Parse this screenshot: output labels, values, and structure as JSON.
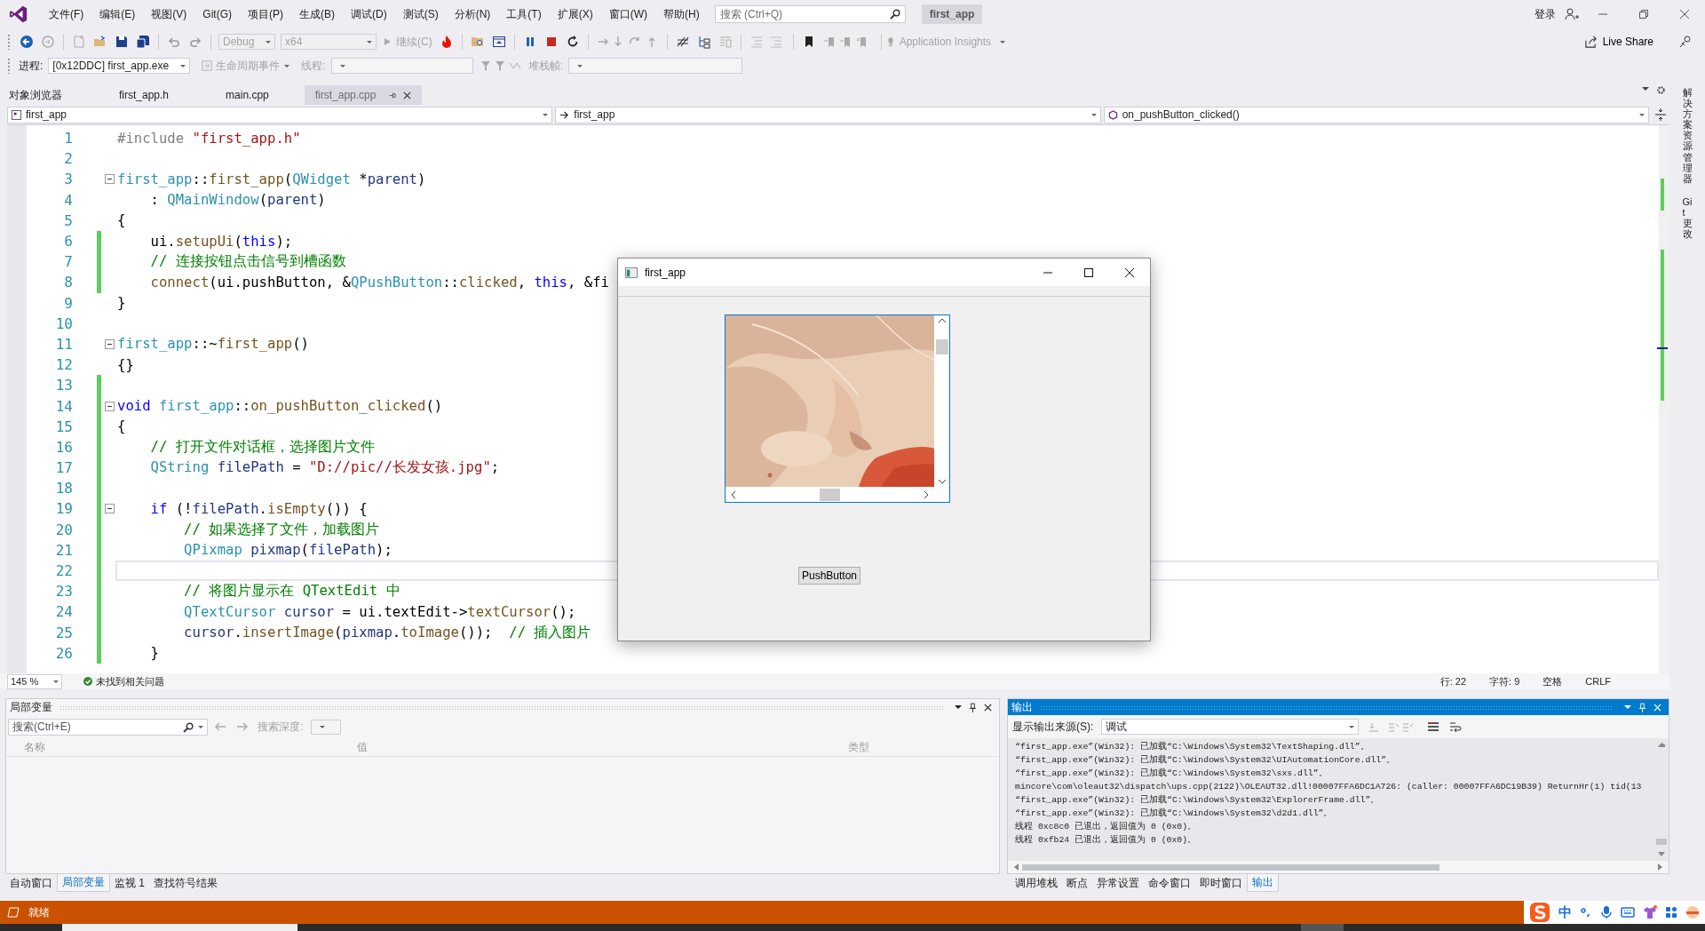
{
  "menu_bar": {
    "items": [
      "文件(F)",
      "编辑(E)",
      "视图(V)",
      "Git(G)",
      "项目(P)",
      "生成(B)",
      "调试(D)",
      "测试(S)",
      "分析(N)",
      "工具(T)",
      "扩展(X)",
      "窗口(W)",
      "帮助(H)"
    ],
    "search": {
      "placeholder": "搜索 (Ctrl+Q)"
    },
    "solution_name": "first_app",
    "sign_in": "登录"
  },
  "toolbar": {
    "configuration": {
      "value": "Debug",
      "disabled": true
    },
    "platform": {
      "value": "x64",
      "disabled": true
    },
    "continue": {
      "label": "继续(C)",
      "disabled": true
    },
    "insights": {
      "label": "Application Insights",
      "disabled": true
    },
    "live_share": "Live Share"
  },
  "debug_location": {
    "process_label": "进程:",
    "process": "[0x12DDC] first_app.exe",
    "lifecycle": "生命周期事件",
    "thread_label": "线程:",
    "stack_label": "堆栈帧:"
  },
  "doc_tabs": [
    {
      "label": "对象浏览器",
      "selected": false
    },
    {
      "label": "first_app.h",
      "selected": false
    },
    {
      "label": "main.cpp",
      "selected": false
    },
    {
      "label": "first_app.cpp",
      "selected": true
    }
  ],
  "nav_bar": {
    "project": "first_app",
    "scope": "first_app",
    "member": "on_pushButton_clicked()"
  },
  "editor": {
    "lines": [
      {
        "number": "1",
        "changed": false,
        "fold": false,
        "current": false,
        "tokens": [
          {
            "kind": "pre",
            "text": "#include "
          },
          {
            "kind": "str",
            "text": "\"first_app.h\""
          }
        ]
      },
      {
        "number": "2",
        "changed": false,
        "fold": false,
        "current": false
      },
      {
        "number": "3",
        "changed": false,
        "fold": true,
        "current": false,
        "tokens": [
          {
            "kind": "cls",
            "text": "first_app"
          },
          {
            "kind": "pl",
            "text": "::"
          },
          {
            "kind": "fn",
            "text": "first_app"
          },
          {
            "kind": "pl",
            "text": "("
          },
          {
            "kind": "cls",
            "text": "QWidget"
          },
          {
            "kind": "pl",
            "text": " *"
          },
          {
            "kind": "var",
            "text": "parent"
          },
          {
            "kind": "pl",
            "text": ")"
          }
        ]
      },
      {
        "number": "4",
        "changed": false,
        "fold": false,
        "current": false,
        "tokens": [
          {
            "kind": "pl",
            "text": "    : "
          },
          {
            "kind": "cls",
            "text": "QMainWindow"
          },
          {
            "kind": "pl",
            "text": "("
          },
          {
            "kind": "var",
            "text": "parent"
          },
          {
            "kind": "pl",
            "text": ")"
          }
        ]
      },
      {
        "number": "5",
        "changed": false,
        "fold": false,
        "current": false,
        "tokens": [
          {
            "kind": "pl",
            "text": "{"
          }
        ]
      },
      {
        "number": "6",
        "changed": true,
        "fold": false,
        "current": false,
        "tokens": [
          {
            "kind": "pl",
            "text": "    ui."
          },
          {
            "kind": "fn",
            "text": "setupUi"
          },
          {
            "kind": "pl",
            "text": "("
          },
          {
            "kind": "kw",
            "text": "this"
          },
          {
            "kind": "pl",
            "text": ");"
          }
        ]
      },
      {
        "number": "7",
        "changed": true,
        "fold": false,
        "current": false,
        "tokens": [
          {
            "kind": "cm",
            "text": "    // 连接按钮点击信号到槽函数"
          }
        ]
      },
      {
        "number": "8",
        "changed": true,
        "fold": false,
        "current": false,
        "tokens": [
          {
            "kind": "fn",
            "text": "    connect"
          },
          {
            "kind": "pl",
            "text": "(ui.pushButton, &"
          },
          {
            "kind": "cls",
            "text": "QPushButton"
          },
          {
            "kind": "pl",
            "text": "::"
          },
          {
            "kind": "fn",
            "text": "clicked"
          },
          {
            "kind": "pl",
            "text": ", "
          },
          {
            "kind": "kw",
            "text": "this"
          },
          {
            "kind": "pl",
            "text": ", &fi"
          }
        ]
      },
      {
        "number": "9",
        "changed": false,
        "fold": false,
        "current": false,
        "tokens": [
          {
            "kind": "pl",
            "text": "}"
          }
        ]
      },
      {
        "number": "10",
        "changed": false,
        "fold": false,
        "current": false
      },
      {
        "number": "11",
        "changed": false,
        "fold": true,
        "current": false,
        "tokens": [
          {
            "kind": "cls",
            "text": "first_app"
          },
          {
            "kind": "pl",
            "text": "::~"
          },
          {
            "kind": "fn",
            "text": "first_app"
          },
          {
            "kind": "pl",
            "text": "()"
          }
        ]
      },
      {
        "number": "12",
        "changed": false,
        "fold": false,
        "current": false,
        "tokens": [
          {
            "kind": "pl",
            "text": "{}"
          }
        ]
      },
      {
        "number": "13",
        "changed": true,
        "fold": false,
        "current": false
      },
      {
        "number": "14",
        "changed": true,
        "fold": true,
        "current": false,
        "tokens": [
          {
            "kind": "kw",
            "text": "void "
          },
          {
            "kind": "cls",
            "text": "first_app"
          },
          {
            "kind": "pl",
            "text": "::"
          },
          {
            "kind": "fn",
            "text": "on_pushButton_clicked"
          },
          {
            "kind": "pl",
            "text": "()"
          }
        ]
      },
      {
        "number": "15",
        "changed": true,
        "fold": false,
        "current": false,
        "tokens": [
          {
            "kind": "pl",
            "text": "{"
          }
        ]
      },
      {
        "number": "16",
        "changed": true,
        "fold": false,
        "current": false,
        "tokens": [
          {
            "kind": "cm",
            "text": "    // 打开文件对话框，选择图片文件"
          }
        ]
      },
      {
        "number": "17",
        "changed": true,
        "fold": false,
        "current": false,
        "tokens": [
          {
            "kind": "cls",
            "text": "    QString "
          },
          {
            "kind": "var",
            "text": "filePath"
          },
          {
            "kind": "pl",
            "text": " = "
          },
          {
            "kind": "str",
            "text": "\"D://pic//长发女孩.jpg\""
          },
          {
            "kind": "pl",
            "text": ";"
          }
        ]
      },
      {
        "number": "18",
        "changed": true,
        "fold": false,
        "current": false
      },
      {
        "number": "19",
        "changed": true,
        "fold": true,
        "current": false,
        "tokens": [
          {
            "kind": "kw",
            "text": "    if "
          },
          {
            "kind": "pl",
            "text": "(!"
          },
          {
            "kind": "var",
            "text": "filePath"
          },
          {
            "kind": "pl",
            "text": "."
          },
          {
            "kind": "fn",
            "text": "isEmpty"
          },
          {
            "kind": "pl",
            "text": "()) {"
          }
        ]
      },
      {
        "number": "20",
        "changed": true,
        "fold": false,
        "current": false,
        "tokens": [
          {
            "kind": "cm",
            "text": "        // 如果选择了文件，加载图片"
          }
        ]
      },
      {
        "number": "21",
        "changed": true,
        "fold": false,
        "current": false,
        "tokens": [
          {
            "kind": "cls",
            "text": "        QPixmap "
          },
          {
            "kind": "var",
            "text": "pixmap"
          },
          {
            "kind": "pl",
            "text": "("
          },
          {
            "kind": "var",
            "text": "filePath"
          },
          {
            "kind": "pl",
            "text": ");"
          }
        ]
      },
      {
        "number": "22",
        "changed": true,
        "fold": false,
        "current": true
      },
      {
        "number": "23",
        "changed": true,
        "fold": false,
        "current": false,
        "tokens": [
          {
            "kind": "cm",
            "text": "        // 将图片显示在 QTextEdit 中"
          }
        ]
      },
      {
        "number": "24",
        "changed": true,
        "fold": false,
        "current": false,
        "tokens": [
          {
            "kind": "cls",
            "text": "        QTextCursor "
          },
          {
            "kind": "var",
            "text": "cursor"
          },
          {
            "kind": "pl",
            "text": " = ui.textEdit->"
          },
          {
            "kind": "fn",
            "text": "textCursor"
          },
          {
            "kind": "pl",
            "text": "();"
          }
        ]
      },
      {
        "number": "25",
        "changed": true,
        "fold": false,
        "current": false,
        "tokens": [
          {
            "kind": "var",
            "text": "        cursor"
          },
          {
            "kind": "pl",
            "text": "."
          },
          {
            "kind": "fn",
            "text": "insertImage"
          },
          {
            "kind": "pl",
            "text": "("
          },
          {
            "kind": "var",
            "text": "pixmap"
          },
          {
            "kind": "pl",
            "text": "."
          },
          {
            "kind": "fn",
            "text": "toImage"
          },
          {
            "kind": "pl",
            "text": "());  "
          },
          {
            "kind": "cm",
            "text": "// 插入图片"
          }
        ]
      },
      {
        "number": "26",
        "changed": true,
        "fold": false,
        "current": false,
        "tokens": [
          {
            "kind": "pl",
            "text": "    }"
          }
        ]
      }
    ],
    "zoom": "145 %",
    "issues": "未找到相关问题",
    "position": {
      "line": "行: 22",
      "char": "字符: 9",
      "indent": "空格",
      "eol": "CRLF"
    }
  },
  "app_window": {
    "title": "first_app",
    "button": "PushButton"
  },
  "locals_panel": {
    "title": "局部变量",
    "search": {
      "placeholder": "搜索(Ctrl+E)"
    },
    "depth_label": "搜索深度:",
    "columns": [
      "名称",
      "值",
      "类型"
    ]
  },
  "locals_tabs": [
    {
      "label": "自动窗口",
      "selected": false
    },
    {
      "label": "局部变量",
      "selected": true
    },
    {
      "label": "监视 1",
      "selected": false
    },
    {
      "label": "查找符号结果",
      "selected": false
    }
  ],
  "output_panel": {
    "title": "输出",
    "source_label": "显示输出来源(S):",
    "source": "调试",
    "lines": [
      "“first_app.exe”(Win32): 已加载“C:\\Windows\\System32\\TextShaping.dll”。",
      "“first_app.exe”(Win32): 已加载“C:\\Windows\\System32\\UIAutomationCore.dll”。",
      "“first_app.exe”(Win32): 已加载“C:\\Windows\\System32\\sxs.dll”。",
      "mincore\\com\\oleaut32\\dispatch\\ups.cpp(2122)\\OLEAUT32.dll!00007FFA6DC1A726: (caller: 00007FFA6DC19B39) ReturnHr(1) tid(13",
      "“first_app.exe”(Win32): 已加载“C:\\Windows\\System32\\ExplorerFrame.dll”。",
      "“first_app.exe”(Win32): 已加载“C:\\Windows\\System32\\d2d1.dll”。",
      "线程 0xc8c0 已退出，返回值为 0 (0x0)。",
      "线程 0xfb24 已退出，返回值为 0 (0x0)。"
    ]
  },
  "output_tabs": [
    {
      "label": "调用堆栈",
      "selected": false
    },
    {
      "label": "断点",
      "selected": false
    },
    {
      "label": "异常设置",
      "selected": false
    },
    {
      "label": "命令窗口",
      "selected": false
    },
    {
      "label": "即时窗口",
      "selected": false
    },
    {
      "label": "输出",
      "selected": true
    }
  ],
  "side_tabs": [
    "解决方案资源管理器",
    "Git 更改"
  ],
  "status_bar": {
    "text": "就绪",
    "ime_mode": "中"
  }
}
